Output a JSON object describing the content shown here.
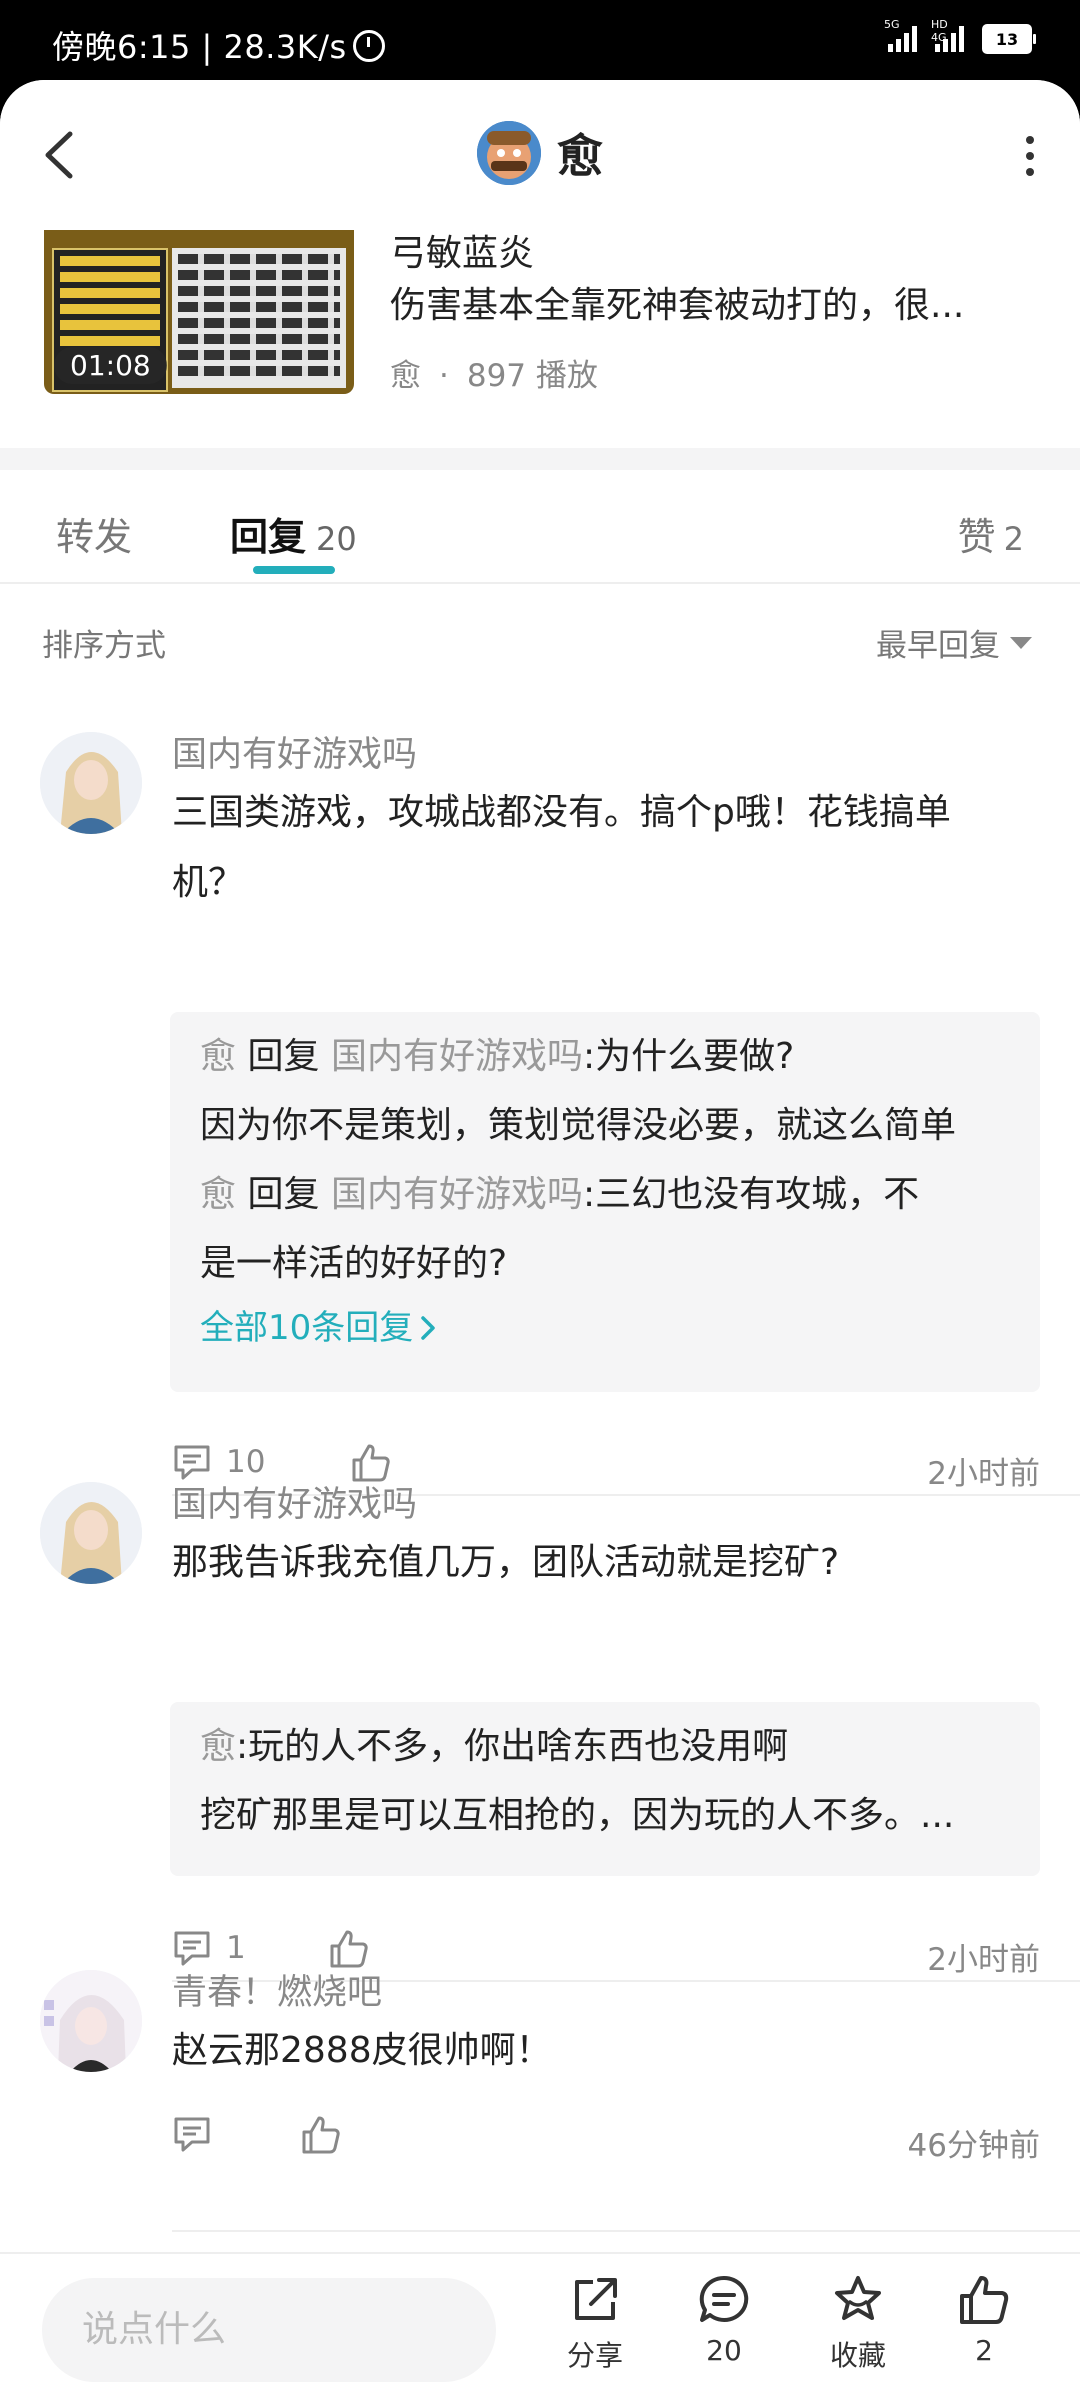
{
  "status_bar": {
    "time_speed": "傍晚6:15 | 28.3K/s",
    "network_5g": "5G",
    "network_hd": "HD 4G",
    "battery": "13"
  },
  "header": {
    "author_name": "愈"
  },
  "video": {
    "title_line1": "弓敏蓝炎",
    "title_line2": "伤害基本全靠死神套被动打的，很...",
    "duration": "01:08",
    "author": "愈",
    "dot": "·",
    "plays": "897 播放"
  },
  "tabs": {
    "forward": "转发",
    "reply": "回复",
    "reply_count": "20",
    "like": "赞",
    "like_count": "2"
  },
  "sort": {
    "label": "排序方式",
    "value": "最早回复"
  },
  "comments": [
    {
      "user": "国内有好游戏吗",
      "text": "三国类游戏，攻城战都没有。搞个p哦！花钱搞单机？",
      "replies": [
        {
          "author": "愈",
          "verb": "回复",
          "target": "国内有好游戏吗",
          "text": ":为什么要做?"
        },
        {
          "text": "因为你不是策划，策划觉得没必要，就这么简单"
        },
        {
          "author": "愈",
          "verb": "回复",
          "target": "国内有好游戏吗",
          "text": ":三幻也没有攻城，不"
        },
        {
          "text": "是一样活的好好的?"
        }
      ],
      "more": "全部10条回复",
      "comment_count": "10",
      "time": "2小时前"
    },
    {
      "user": "国内有好游戏吗",
      "text": "那我告诉我充值几万，团队活动就是挖矿?",
      "replies": [
        {
          "author": "愈",
          "text": ":玩的人不多，你出啥东西也没用啊"
        },
        {
          "text": "挖矿那里是可以互相抢的，因为玩的人不多。..."
        }
      ],
      "comment_count": "1",
      "time": "2小时前"
    },
    {
      "user": "青春！燃烧吧",
      "text": "赵云那2888皮很帅啊！",
      "time": "46分钟前"
    }
  ],
  "bottom_bar": {
    "input_placeholder": "说点什么",
    "share": "分享",
    "comments": "20",
    "favorite": "收藏",
    "likes": "2"
  },
  "colors": {
    "accent": "#23aebb",
    "muted_text": "#888888",
    "sub_reply_bg": "#f5f5f6"
  }
}
